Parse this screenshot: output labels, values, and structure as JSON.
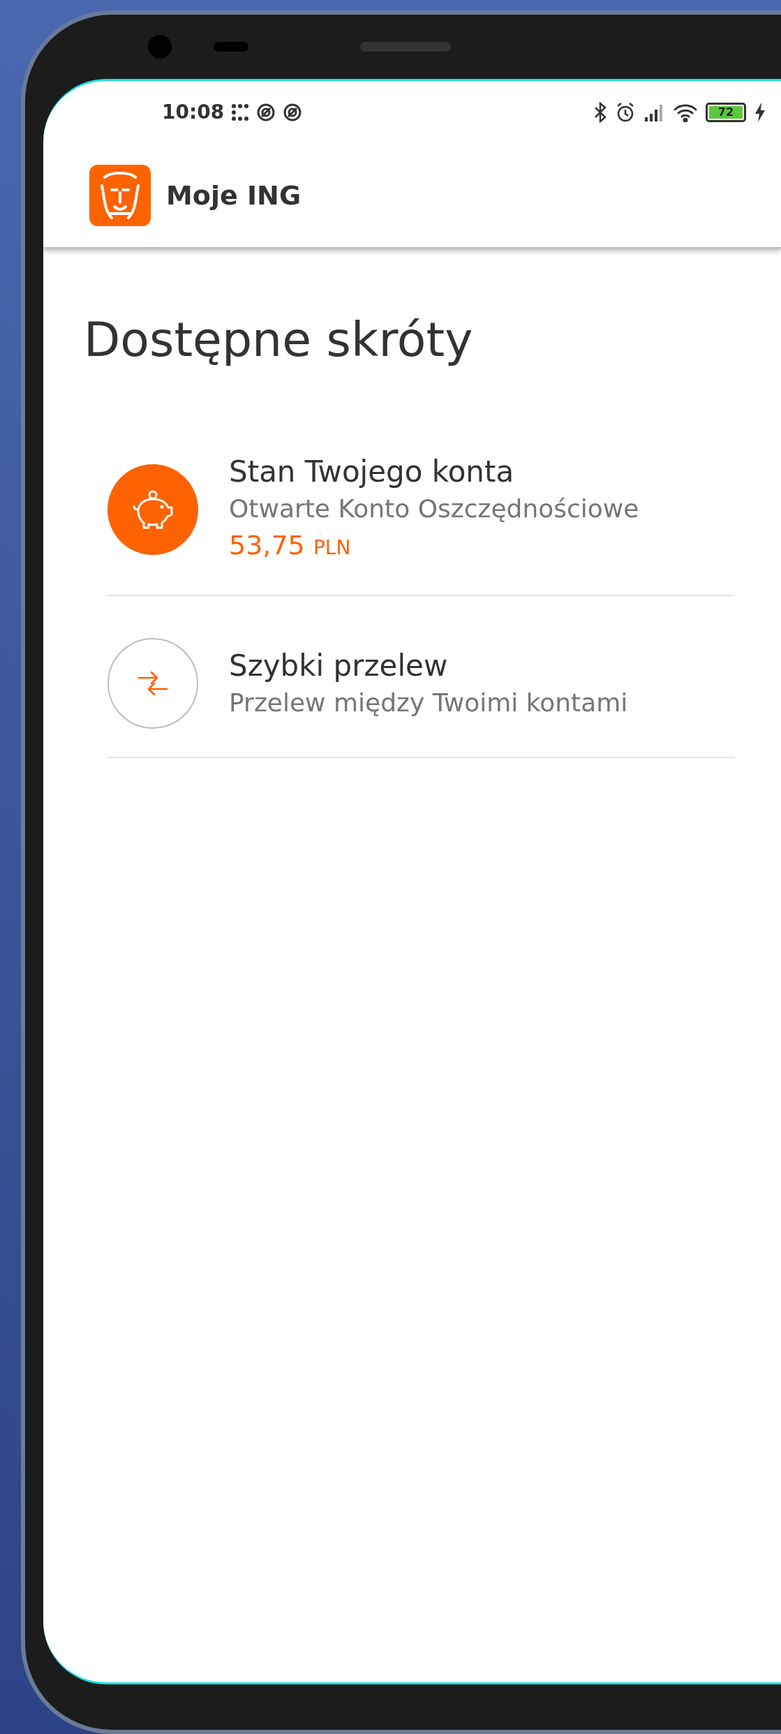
{
  "status_bar": {
    "time": "10:08",
    "battery": "72"
  },
  "app_bar": {
    "title": "Moje ING"
  },
  "page_title": "Dostępne skróty",
  "shortcuts": [
    {
      "kind": "balance",
      "title": "Stan Twojego konta",
      "subtitle": "Otwarte Konto Oszczędnościowe",
      "amount": "53,75",
      "currency": "PLN"
    },
    {
      "kind": "transfer",
      "title": "Szybki przelew",
      "subtitle": "Przelew między Twoimi kontami"
    }
  ]
}
